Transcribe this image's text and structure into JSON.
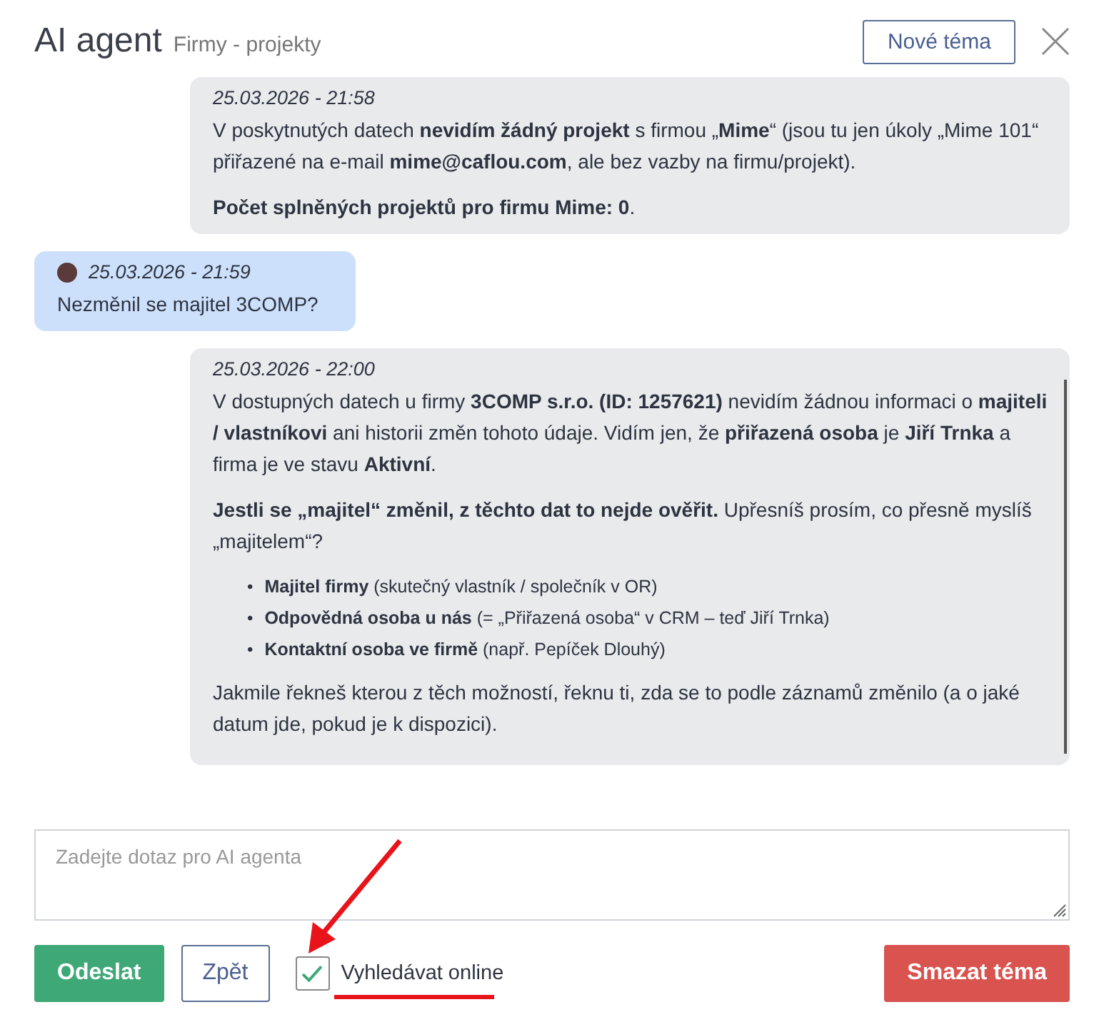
{
  "header": {
    "title": "AI agent",
    "subtitle": "Firmy - projekty",
    "new_topic_button": "Nové téma"
  },
  "messages": [
    {
      "kind": "agent",
      "timestamp": "25.03.2026 - 21:58",
      "blocks": [
        {
          "kind": "paragraph",
          "text": "V poskytnutých datech **nevidím žádný projekt** s firmou „**Mime**“ (jsou tu jen úkoly „Mime 101“ přiřazené na e-mail **mime@caflou.com**, ale bez vazby na firmu/projekt)."
        },
        {
          "kind": "paragraph",
          "text": "**Počet splněných projektů pro firmu Mime: 0**."
        }
      ]
    },
    {
      "kind": "user",
      "timestamp": "25.03.2026 - 21:59",
      "blocks": [
        {
          "kind": "paragraph",
          "text": "Nezměnil se majitel 3COMP?"
        }
      ]
    },
    {
      "kind": "agent",
      "timestamp": "25.03.2026 - 22:00",
      "blocks": [
        {
          "kind": "paragraph",
          "text": "V dostupných datech u firmy **3COMP s.r.o. (ID: 1257621)** nevidím žádnou informaci o **majiteli / vlastníkovi** ani historii změn tohoto údaje. Vidím jen, že **přiřazená osoba** je **Jiří Trnka** a firma je ve stavu **Aktivní**."
        },
        {
          "kind": "paragraph",
          "text": "**Jestli se „majitel“ změnil, z těchto dat to nejde ověřit.** Upřesníš prosím, co přesně myslíš „majitelem“?"
        },
        {
          "kind": "list",
          "marker": "•",
          "items": [
            "**Majitel firmy** (skutečný vlastník / společník v OR)",
            "**Odpovědná osoba u nás** (= „Přiřazená osoba“ v CRM – teď Jiří Trnka)",
            "**Kontaktní osoba ve firmě** (např. Pepíček Dlouhý)"
          ]
        },
        {
          "kind": "paragraph",
          "text": "Jakmile řekneš kterou z těch možností, řeknu ti, zda se to podle záznamů změnilo (a o jaké datum jde, pokud je k dispozici)."
        }
      ]
    }
  ],
  "composer": {
    "placeholder": "Zadejte dotaz pro AI agenta"
  },
  "actions": {
    "send_button": "Odeslat",
    "back_button": "Zpět",
    "online_search": {
      "label": "Vyhledávat online",
      "checked": true
    },
    "delete_button": "Smazat téma"
  }
}
